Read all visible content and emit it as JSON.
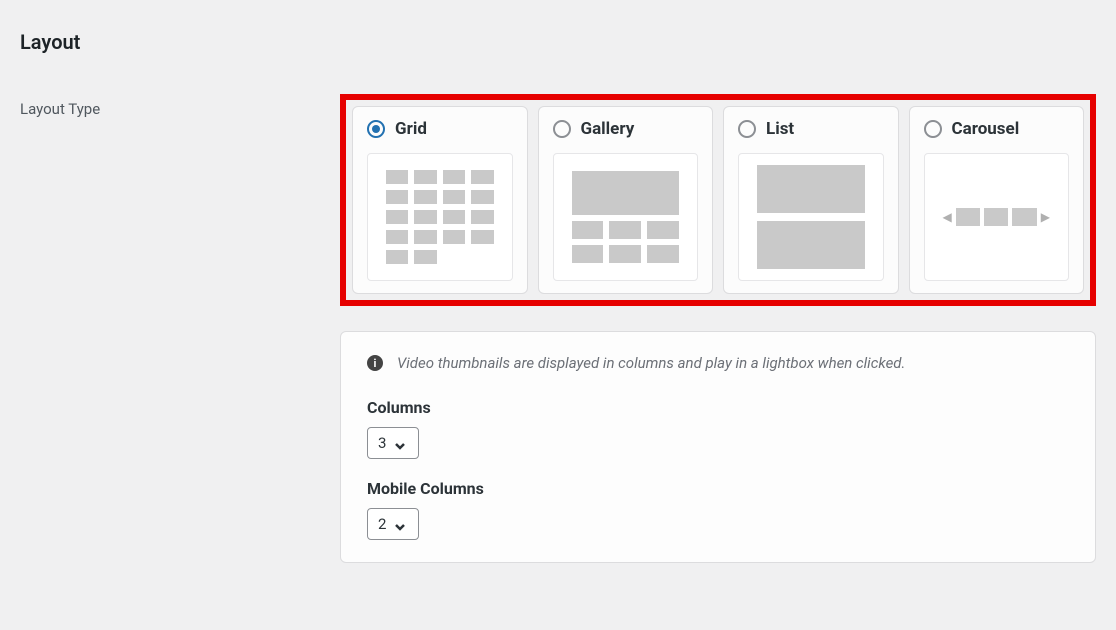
{
  "section": {
    "title": "Layout"
  },
  "layout_type": {
    "label": "Layout Type",
    "selected": "grid",
    "options": [
      {
        "id": "grid",
        "label": "Grid"
      },
      {
        "id": "gallery",
        "label": "Gallery"
      },
      {
        "id": "list",
        "label": "List"
      },
      {
        "id": "carousel",
        "label": "Carousel"
      }
    ]
  },
  "info": {
    "text": "Video thumbnails are displayed in columns and play in a lightbox when clicked."
  },
  "columns": {
    "label": "Columns",
    "value": "3"
  },
  "mobile_columns": {
    "label": "Mobile Columns",
    "value": "2"
  }
}
